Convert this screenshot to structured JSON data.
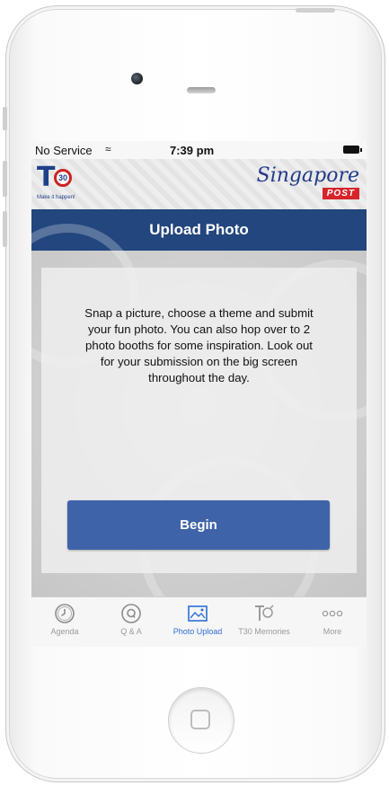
{
  "status_bar": {
    "carrier": "No Service",
    "time": "7:39 pm"
  },
  "brand": {
    "t30_logo_text": "T30",
    "t30_badge": "30",
    "t30_tagline": "Make it happen!",
    "singpost_script": "Singapore",
    "singpost_post": "POST"
  },
  "navbar": {
    "title": "Upload Photo"
  },
  "main": {
    "message": "Snap a picture, choose a theme and submit your fun photo. You can also hop over to 2 photo booths for some inspiration. Look out for your submission on the big screen throughout the day.",
    "begin_label": "Begin"
  },
  "tabs": [
    {
      "label": "Agenda",
      "icon": "clock-icon"
    },
    {
      "label": "Q & A",
      "icon": "q-icon"
    },
    {
      "label": "Photo Upload",
      "icon": "photo-icon",
      "active": true
    },
    {
      "label": "T30 Memories",
      "icon": "t30-icon"
    },
    {
      "label": "More",
      "icon": "more-icon"
    }
  ],
  "colors": {
    "navbar": "#22467d",
    "button": "#3f63a8",
    "active_tab": "#2c6fd6"
  }
}
